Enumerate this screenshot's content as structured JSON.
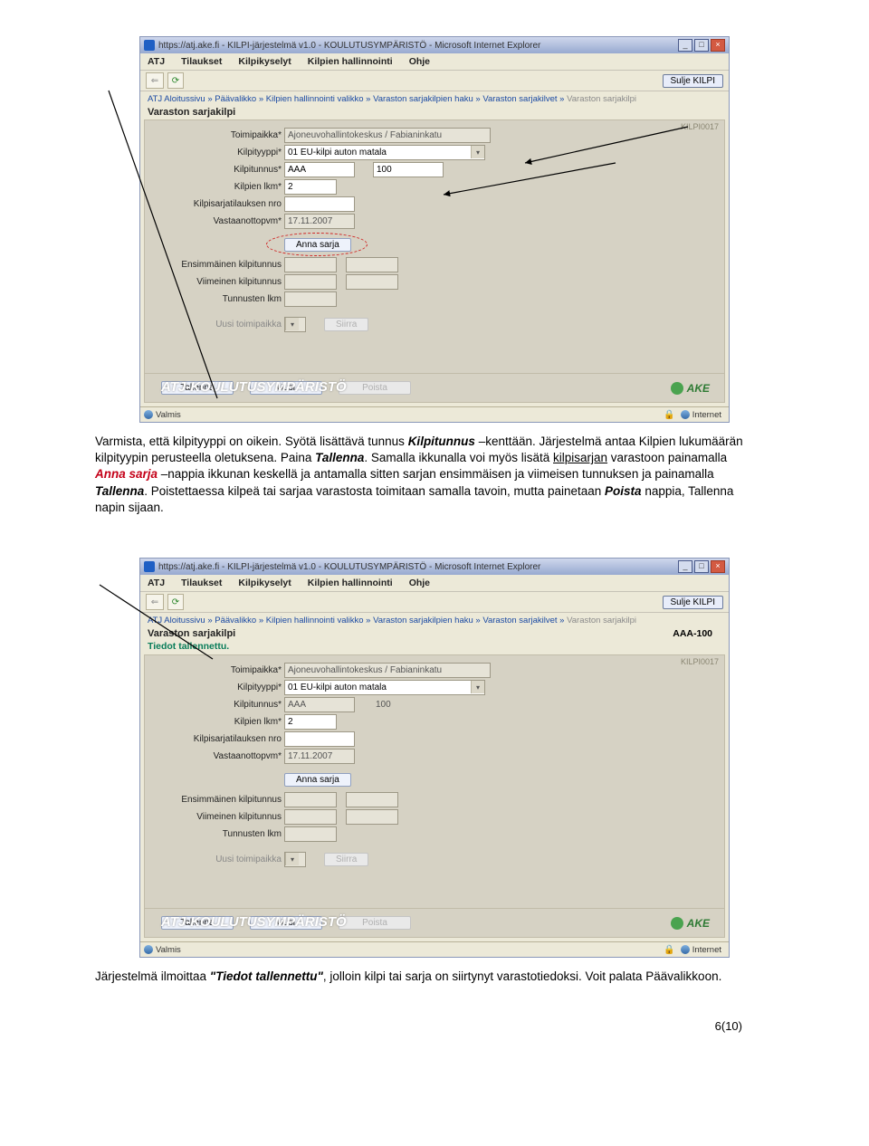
{
  "window1": {
    "title": "https://atj.ake.fi - KILPI-järjestelmä v1.0 - KOULUTUSYMPÄRISTÖ - Microsoft Internet Explorer",
    "menu": [
      "ATJ",
      "Tilaukset",
      "Kilpikyselyt",
      "Kilpien hallinnointi",
      "Ohje"
    ],
    "close_btn": "Sulje KILPI",
    "breadcrumb": "ATJ Aloitussivu » Päävalikko » Kilpien hallinnointi valikko » Varaston sarjakilpien haku » Varaston sarjakilvet » ",
    "breadcrumb_current": "Varaston sarjakilpi",
    "app_title": "Varaston sarjakilpi",
    "code": "KILPI0017",
    "fields": {
      "toimipaikka_label": "Toimipaikka*",
      "toimipaikka_value": "Ajoneuvohallintokeskus / Fabianinkatu",
      "kilpityyppi_label": "Kilpityyppi*",
      "kilpityyppi_value": "01 EU-kilpi auton matala",
      "kilpitunnus_label": "Kilpitunnus*",
      "kilpitunnus_value_a": "AAA",
      "kilpitunnus_value_b": "100",
      "kilpien_lkm_label": "Kilpien lkm*",
      "kilpien_lkm_value": "2",
      "kilpisarjatilauksen_label": "Kilpisarjatilauksen nro",
      "vastaanottopvm_label": "Vastaanottopvm*",
      "vastaanottopvm_value": "17.11.2007",
      "anna_sarja": "Anna sarja",
      "ensimmainen_label": "Ensimmäinen kilpitunnus",
      "viimeinen_label": "Viimeinen kilpitunnus",
      "tunnusten_label": "Tunnusten lkm",
      "uusi_toimipaikka_label": "Uusi toimipaikka",
      "siirra": "Siirra"
    },
    "footer": {
      "tallenna": "Tallenna",
      "uusi": "Uusi",
      "poista": "Poista"
    },
    "overlay": "ATJ-KOULUTUSYMPÄRISTÖ",
    "ake": "AKE",
    "status_valmis": "Valmis",
    "status_net": "Internet"
  },
  "desc1_parts": {
    "a": "Varmista, että kilpityyppi on oikein. Syötä lisättävä tunnus ",
    "b": "Kilpitunnus",
    "c": " –kenttään. Järjestelmä antaa Kilpien lukumäärän kilpityypin perusteella oletuksena. Paina ",
    "d": "Tallenna",
    "e": ". Samalla ikkunalla voi myös lisätä ",
    "f": "kilpisarjan",
    "g": " varastoon painamalla ",
    "h": "Anna sarja",
    "i": " –nappia ikkunan keskellä ja antamalla sitten sarjan ensimmäisen ja viimeisen tunnuksen ja painamalla ",
    "j": "Tallenna",
    "k": ".\nPoistettaessa kilpeä tai sarjaa varastosta toimitaan samalla tavoin, mutta painetaan ",
    "l": "Poista",
    "m": " nappia, Tallenna napin sijaan."
  },
  "window2": {
    "title": "https://atj.ake.fi - KILPI-järjestelmä v1.0 - KOULUTUSYMPÄRISTÖ - Microsoft Internet Explorer",
    "status_msg": "Tiedot tallennettu.",
    "aaa": "AAA-100"
  },
  "desc2_parts": {
    "a": "Järjestelmä ilmoittaa ",
    "b": "\"Tiedot tallennettu\"",
    "c": ", jolloin kilpi tai sarja on siirtynyt varastotiedoksi. Voit palata Päävalikkoon."
  },
  "page_num": "6(10)"
}
